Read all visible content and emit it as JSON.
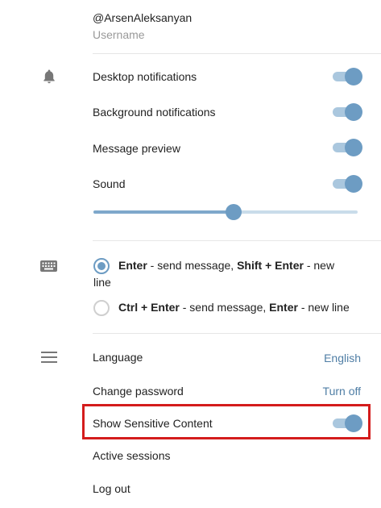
{
  "profile": {
    "username_value": "@ArsenAleksanyan",
    "username_label": "Username"
  },
  "notifications": {
    "icon": "bell-icon",
    "desktop_label": "Desktop notifications",
    "background_label": "Background notifications",
    "preview_label": "Message preview",
    "sound_label": "Sound",
    "toggles": {
      "desktop": true,
      "background": true,
      "preview": true,
      "sound": true
    },
    "volume_level": 0.53
  },
  "send": {
    "icon": "keyboard-icon",
    "option1": {
      "selected": true,
      "key1": "Enter",
      "text1": " - send message, ",
      "key2": "Shift + Enter",
      "text2": " - new",
      "line2": "line"
    },
    "option2": {
      "selected": false,
      "key1": "Ctrl + Enter",
      "text1": " - send message, ",
      "key2": "Enter",
      "text2": " - new line"
    }
  },
  "general": {
    "icon": "menu-icon",
    "language_label": "Language",
    "language_value": "English",
    "password_label": "Change password",
    "password_action": "Turn off",
    "sensitive_label": "Show Sensitive Content",
    "sensitive_enabled": true,
    "sessions_label": "Active sessions",
    "logout_label": "Log out"
  },
  "colors": {
    "accent": "#6d9cc3",
    "accent_light": "#aac7de",
    "link": "#4f7ea5",
    "highlight": "#d41c1c"
  }
}
